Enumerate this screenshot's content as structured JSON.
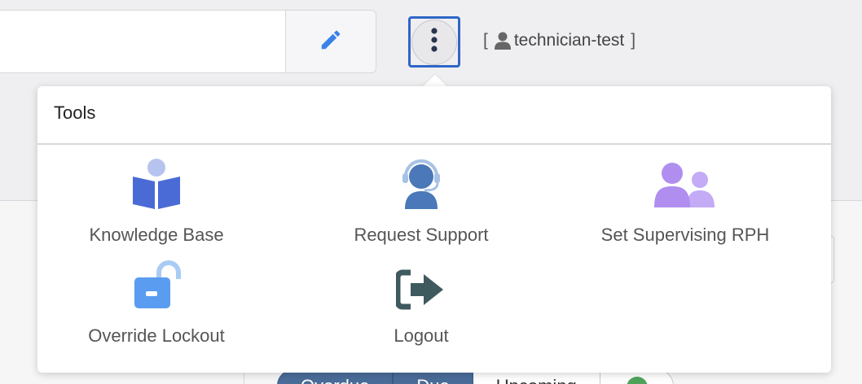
{
  "header": {
    "more_menu_label": "More options",
    "user": {
      "bracket_open": "[",
      "name": "technician-test",
      "bracket_close": "]"
    }
  },
  "tools_menu": {
    "title": "Tools",
    "items": [
      {
        "label": "Knowledge Base",
        "icon": "book-reader-icon",
        "color": "#4a6bd6"
      },
      {
        "label": "Request Support",
        "icon": "headset-icon",
        "color": "#4a78b8"
      },
      {
        "label": "Set Supervising RPH",
        "icon": "users-icon",
        "color": "#b08ef0"
      },
      {
        "label": "Override Lockout",
        "icon": "unlock-icon",
        "color": "#5a9cf0"
      },
      {
        "label": "Logout",
        "icon": "sign-out-icon",
        "color": "#3e5a5e"
      }
    ]
  },
  "background": {
    "filters": [
      {
        "label": "Overdue"
      },
      {
        "label": "Due"
      },
      {
        "label": "Upcoming"
      }
    ]
  },
  "colors": {
    "accent_blue": "#2f66c8",
    "edit_icon": "#3b82e8"
  }
}
